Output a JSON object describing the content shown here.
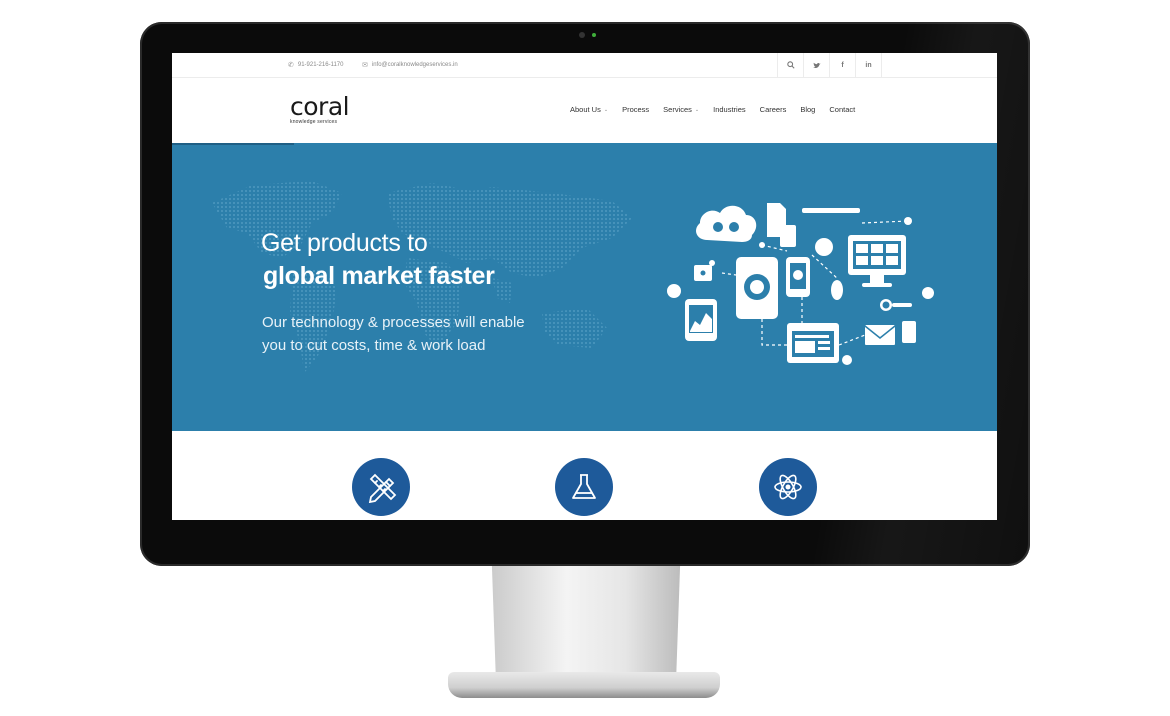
{
  "topbar": {
    "phone": "91-921-216-1170",
    "email": "info@coralknowledgeservices.in",
    "social": [
      {
        "icon": "search-icon",
        "glyph": "⌕"
      },
      {
        "icon": "twitter-icon",
        "glyph": "🐦"
      },
      {
        "icon": "facebook-icon",
        "glyph": "f"
      },
      {
        "icon": "linkedin-icon",
        "glyph": "in"
      }
    ]
  },
  "brand": {
    "name": "coral",
    "tagline": "knowledge services"
  },
  "nav": {
    "items": [
      {
        "label": "About Us",
        "has_dropdown": true
      },
      {
        "label": "Process",
        "has_dropdown": false
      },
      {
        "label": "Services",
        "has_dropdown": true
      },
      {
        "label": "Industries",
        "has_dropdown": false
      },
      {
        "label": "Careers",
        "has_dropdown": false
      },
      {
        "label": "Blog",
        "has_dropdown": false
      },
      {
        "label": "Contact",
        "has_dropdown": false
      }
    ]
  },
  "hero": {
    "headline_line1": "Get products to",
    "headline_line2": "global market faster",
    "subtext_line1": "Our technology & processes will enable",
    "subtext_line2": "you to cut costs, time & work load",
    "background_color": "#2c7fab"
  },
  "features": [
    {
      "icon": "design-tools-icon"
    },
    {
      "icon": "flask-icon"
    },
    {
      "icon": "atom-icon"
    }
  ],
  "colors": {
    "hero_blue": "#2c7fab",
    "feature_blue": "#1e5a9a"
  }
}
